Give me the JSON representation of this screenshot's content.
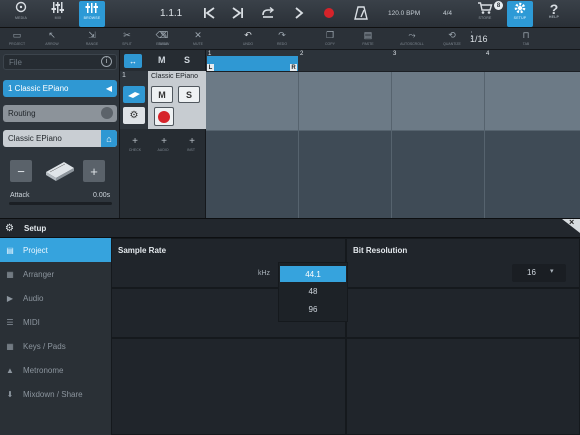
{
  "top_toolbar": {
    "media_label": "MEDIA",
    "mix_label": "MIX",
    "browse_label": "BROWSE",
    "position": "1.1.1",
    "tempo": "120.0 BPM",
    "signature": "4/4",
    "store_label": "STORE",
    "store_badge": "8",
    "setup_label": "SETUP",
    "help_label": "HELP"
  },
  "tools": {
    "project": "PROJECT",
    "arrow": "ARROW",
    "range": "RANGE",
    "split": "SPLIT",
    "erase": "ERASE",
    "draw": "DRAW",
    "mute": "MUTE",
    "undo": "UNDO",
    "redo": "REDO",
    "copy": "COPY",
    "paste": "PASTE",
    "autoscroll": "AUTOSCROLL",
    "quantize": "QUANTIZE",
    "grid": "1/16",
    "tab_label": "TAB"
  },
  "inspector": {
    "file_label": "File",
    "info_icon_label": "i",
    "track_name": "1  Classic EPiano",
    "routing": "Routing",
    "instrument": "Classic EPiano",
    "attack_label": "Attack",
    "attack_value": "0.00s",
    "attack_level": 0.0
  },
  "track": {
    "number": "1",
    "name": "Classic EPiano",
    "mute": "M",
    "solo": "S",
    "headers_mute": "M",
    "headers_solo": "S",
    "bottom_labels": [
      "CHECK",
      "AUDIO",
      "INST"
    ]
  },
  "ruler": {
    "bars": [
      "1",
      "2",
      "3",
      "4"
    ],
    "loop_left": "L",
    "loop_right": "R"
  },
  "setup": {
    "title": "Setup",
    "close": "×",
    "nav": [
      {
        "label": "Project",
        "icon": "project-icon",
        "glyph": "▤",
        "active": true
      },
      {
        "label": "Arranger",
        "icon": "arranger-icon",
        "glyph": "▦",
        "active": false
      },
      {
        "label": "Audio",
        "icon": "audio-icon",
        "glyph": "▶",
        "active": false
      },
      {
        "label": "MIDI",
        "icon": "midi-icon",
        "glyph": "☰",
        "active": false
      },
      {
        "label": "Keys / Pads",
        "icon": "keys-icon",
        "glyph": "▦",
        "active": false
      },
      {
        "label": "Metronome",
        "icon": "metronome-icon",
        "glyph": "▲",
        "active": false
      },
      {
        "label": "Mixdown / Share",
        "icon": "mixdown-icon",
        "glyph": "⬇",
        "active": false
      }
    ],
    "sample_rate": {
      "header": "Sample Rate",
      "unit": "kHz",
      "options": [
        "44.1",
        "48",
        "96"
      ],
      "selected": "44.1"
    },
    "bit_resolution": {
      "header": "Bit Resolution",
      "value": "16",
      "arrow": "▾"
    }
  },
  "colors": {
    "accent": "#36a3dd",
    "record": "#d6232a"
  }
}
